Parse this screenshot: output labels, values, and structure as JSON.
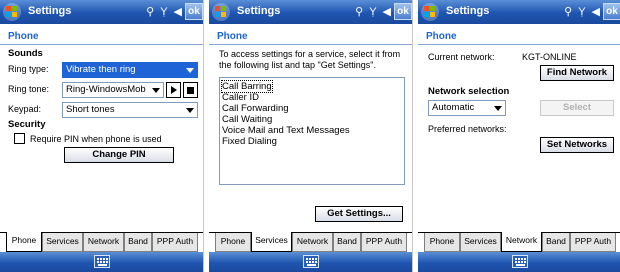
{
  "titlebar": {
    "title": "Settings",
    "ok_label": "ok"
  },
  "screen1": {
    "heading": "Phone",
    "sounds_title": "Sounds",
    "ring_type_label": "Ring type:",
    "ring_type_value": "Vibrate then ring",
    "ring_tone_label": "Ring tone:",
    "ring_tone_value": "Ring-WindowsMob",
    "keypad_label": "Keypad:",
    "keypad_value": "Short tones",
    "security_title": "Security",
    "require_pin_label": "Require PIN when phone is used",
    "change_pin_label": "Change PIN"
  },
  "screen2": {
    "heading": "Phone",
    "instructions_line1": "To access settings for a service, select it from",
    "instructions_line2": "the following list and tap \"Get Settings\".",
    "services": [
      "Call Barring",
      "Caller ID",
      "Call Forwarding",
      "Call Waiting",
      "Voice Mail and Text Messages",
      "Fixed Dialing"
    ],
    "get_settings_label": "Get Settings..."
  },
  "screen3": {
    "heading": "Phone",
    "current_network_label": "Current network:",
    "current_network_value": "KGT-ONLINE",
    "find_network_label": "Find Network",
    "network_selection_title": "Network selection",
    "network_selection_value": "Automatic",
    "select_label": "Select",
    "preferred_networks_label": "Preferred networks:",
    "set_networks_label": "Set Networks"
  },
  "tabs": [
    "Phone",
    "Services",
    "Network",
    "Band",
    "PPP Auth"
  ],
  "active_tabs": [
    "Phone",
    "Services",
    "Network"
  ]
}
